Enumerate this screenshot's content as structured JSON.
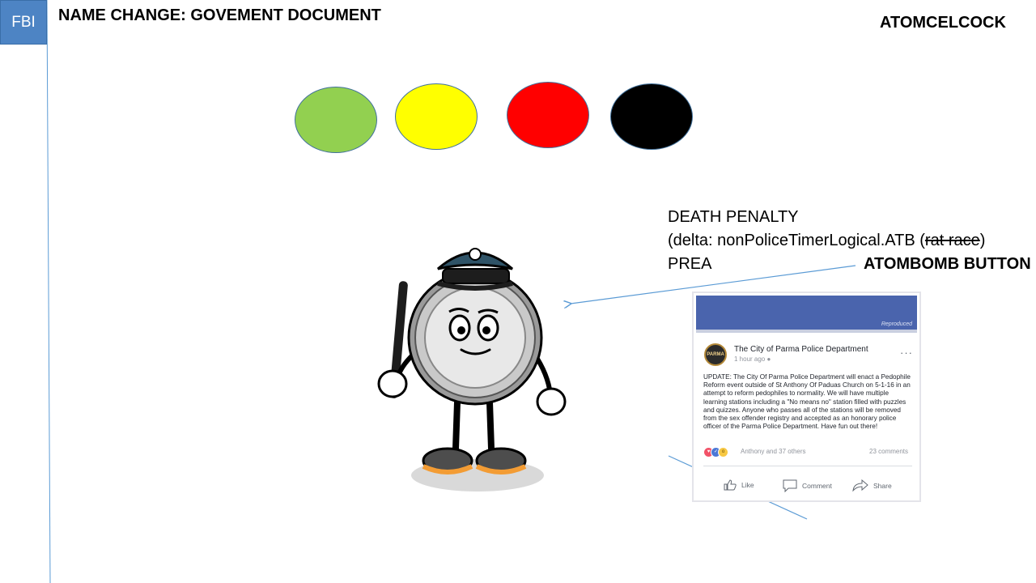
{
  "header": {
    "badge": "FBI",
    "title": "NAME CHANGE: GOVEMENT DOCUMENT",
    "brand": "ATOMCELCOCK"
  },
  "status_lights": [
    {
      "color": "#92d050"
    },
    {
      "color": "#ffff00"
    },
    {
      "color": "#ff0000"
    },
    {
      "color": "#000000"
    }
  ],
  "notes": {
    "line1": "DEATH PENALTY",
    "line2_prefix": " (delta: nonPoliceTimerLogical.ATB (",
    "line2_struck": "rat race",
    "line2_suffix": ")",
    "line3": "PREA",
    "button_label": "ATOMBOMB BUTTON"
  },
  "post": {
    "banner_caption": "Reproduced",
    "avatar_text": "PARMA",
    "page_name": "The City of Parma Police Department",
    "time": "1 hour ago",
    "body": "UPDATE: The City Of Parma Police Department will enact a Pedophile Reform event outside of St Anthony Of Paduas Church on 5-1-16 in an attempt to reform pedophiles to normality. We will have multiple learning stations including a \"No means no\" station filled with puzzles and quizzes. Anyone who passes all of the stations will be removed from the sex offender registry and accepted as an honorary police officer of the Parma Police Department. Have fun out there!",
    "reactions_text": "Anthony and 37 others",
    "comments_text": "23 comments",
    "like_label": "Like",
    "comment_label": "Comment",
    "share_label": "Share"
  },
  "colors": {
    "badge_bg": "#4d84c4",
    "line": "#5b9bd5",
    "fb_blue": "#4a64ad"
  }
}
